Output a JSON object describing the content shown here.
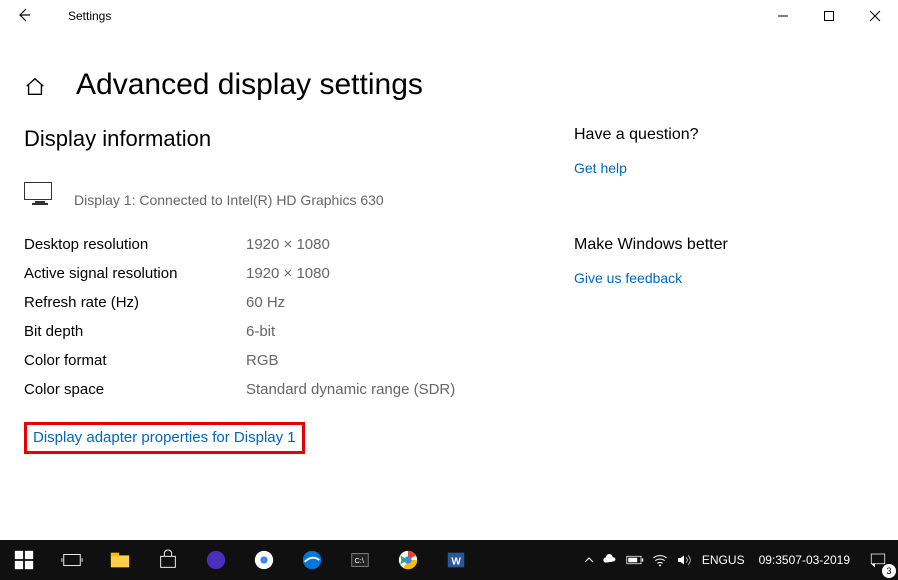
{
  "window": {
    "title": "Settings"
  },
  "page": {
    "title": "Advanced display settings",
    "section_title": "Display information",
    "display_connected": "Display 1: Connected to Intel(R) HD Graphics 630",
    "rows": {
      "desktop_res_label": "Desktop resolution",
      "desktop_res_value": "1920 × 1080",
      "active_res_label": "Active signal resolution",
      "active_res_value": "1920 × 1080",
      "refresh_label": "Refresh rate (Hz)",
      "refresh_value": "60 Hz",
      "bitdepth_label": "Bit depth",
      "bitdepth_value": "6-bit",
      "colorformat_label": "Color format",
      "colorformat_value": "RGB",
      "colorspace_label": "Color space",
      "colorspace_value": "Standard dynamic range (SDR)"
    },
    "adapter_link": "Display adapter properties for Display 1"
  },
  "sidebar": {
    "question_title": "Have a question?",
    "get_help": "Get help",
    "improve_title": "Make Windows better",
    "feedback": "Give us feedback"
  },
  "taskbar": {
    "lang1": "ENG",
    "lang2": "US",
    "time": "09:35",
    "date": "07-03-2019",
    "notif_count": "3"
  }
}
